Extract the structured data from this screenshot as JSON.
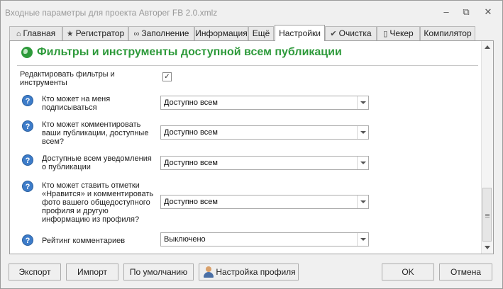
{
  "window": {
    "title": "Входные параметры для проекта Авторег FB 2.0.xmlz",
    "controls": {
      "minimize": "–",
      "restore": "⧉",
      "close": "✕"
    }
  },
  "tabs": [
    {
      "label": "Главная",
      "icon": "home-icon",
      "glyph": "⌂"
    },
    {
      "label": "Регистратор",
      "icon": "star-icon",
      "glyph": "★"
    },
    {
      "label": "Заполнение",
      "icon": "infinity-icon",
      "glyph": "∞"
    },
    {
      "label": "Информация"
    },
    {
      "label": "Ещё"
    },
    {
      "label": "Настройки",
      "active": true
    },
    {
      "label": "Очистка",
      "icon": "check-icon",
      "glyph": "✔"
    },
    {
      "label": "Чекер",
      "icon": "phone-icon",
      "glyph": "▯"
    },
    {
      "label": "Компилятор"
    }
  ],
  "section": {
    "title": "Фильтры и инструменты доступной всем публикации",
    "icon": "globe-icon",
    "accent_color": "#2e9a3b"
  },
  "settings": {
    "edit_filters": {
      "label_line1": "Редактировать фильтры и",
      "label_line2": "инструменты",
      "checked": true,
      "check_glyph": "✓"
    },
    "who_can_subscribe": {
      "line1": "Кто может на меня",
      "line2": "подписываться",
      "value": "Доступно всем"
    },
    "who_can_comment": {
      "line1": "Кто может комментировать",
      "line2": "ваши публикации, доступные",
      "line3": "всем?",
      "value": "Доступно всем"
    },
    "notifications": {
      "line1": "Доступные всем уведомления",
      "line2": "о публикации",
      "value": "Доступно всем"
    },
    "likes_comments": {
      "line1": "Кто может ставить отметки",
      "line2": "«Нравится» и комментировать",
      "line3": "фото вашего общедоступного",
      "line4": "профиля и другую",
      "line5": "информацию из профиля?",
      "value": "Доступно всем"
    },
    "comment_rating": {
      "line1": "Рейтинг комментариев",
      "value": "Выключено"
    }
  },
  "help_glyph": "?",
  "buttons": {
    "export": "Экспорт",
    "import": "Импорт",
    "defaults": "По умолчанию",
    "profile_settings": "Настройка профиля",
    "ok": "OK",
    "cancel": "Отмена"
  }
}
